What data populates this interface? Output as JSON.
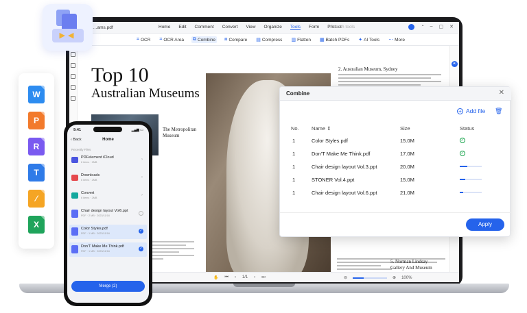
{
  "app": {
    "file_name": "…ams.pdf",
    "menu": [
      "Home",
      "Edit",
      "Comment",
      "Convert",
      "View",
      "Organize",
      "Tools",
      "Form",
      "Protect"
    ],
    "active_menu": "Tools",
    "search_placeholder": "Search tools"
  },
  "toolbar": {
    "tools": [
      {
        "label": "OCR",
        "icon": "ocr-icon"
      },
      {
        "label": "OCR Area",
        "icon": "ocr-area-icon"
      },
      {
        "label": "Combine",
        "icon": "combine-icon",
        "active": true
      },
      {
        "label": "Compare",
        "icon": "compare-icon"
      },
      {
        "label": "Compress",
        "icon": "compress-icon"
      },
      {
        "label": "Flatten",
        "icon": "flatten-icon"
      },
      {
        "label": "Batch PDFs",
        "icon": "batch-icon"
      },
      {
        "label": "AI Tools",
        "icon": "ai-icon"
      },
      {
        "label": "More",
        "icon": "more-icon"
      }
    ]
  },
  "document": {
    "title_line1": "Top 10",
    "title_line2": "Australian Museums",
    "photo_caption": "The Metropolitan Museum",
    "right_heading": "2. Australian Museum, Sydney",
    "section5_line1": "5. Norman Lindsay",
    "section5_line2": "Gallery And Museum"
  },
  "statusbar": {
    "page": "1/1",
    "zoom": "100%",
    "zoom_level": 0.32
  },
  "dialog": {
    "title": "Combine",
    "add_file": "Add file",
    "columns": {
      "no": "No.",
      "name": "Name",
      "size": "Size",
      "status": "Status"
    },
    "files": [
      {
        "no": "1",
        "name": "Color Styles.pdf",
        "size": "15.0M",
        "status": "done"
      },
      {
        "no": "1",
        "name": "Don'T Make Me Think.pdf",
        "size": "17.0M",
        "status": "done"
      },
      {
        "no": "1",
        "name": "Chair design layout Vol.3.ppt",
        "size": "20.0M",
        "status": "progress",
        "progress": 0.35
      },
      {
        "no": "1",
        "name": "STONER Vol.4.ppt",
        "size": "15.0M",
        "status": "progress",
        "progress": 0.25
      },
      {
        "no": "1",
        "name": "Chair design layout Vol.6.ppt",
        "size": "21.0M",
        "status": "progress",
        "progress": 0.15
      }
    ],
    "apply_label": "Apply"
  },
  "file_type_icons": [
    {
      "letter": "W",
      "color": "#2d8cf0",
      "icon": "word-icon"
    },
    {
      "letter": "P",
      "color": "#f27a2c",
      "icon": "powerpoint-icon"
    },
    {
      "letter": "R",
      "color": "#7a5af0",
      "icon": "rtf-icon"
    },
    {
      "letter": "T",
      "color": "#2f7be8",
      "icon": "text-icon"
    },
    {
      "letter": "⁄",
      "color": "#f5a524",
      "icon": "pages-icon"
    },
    {
      "letter": "X",
      "color": "#1fa45b",
      "icon": "excel-icon"
    }
  ],
  "phone": {
    "time": "9:41",
    "back": "Back",
    "title": "Home",
    "section": "Recently Files",
    "items": [
      {
        "name": "PDFelement iCloud",
        "meta": "6 items · 2MB",
        "color": "#4a55e0",
        "type": "folder",
        "control": "chevron",
        "selected": false
      },
      {
        "name": "Downloads",
        "meta": "6 items · 2MB",
        "color": "#e5484d",
        "type": "folder",
        "control": "chevron",
        "selected": false
      },
      {
        "name": "Convert",
        "meta": "6 items · 2MB",
        "color": "#13a89e",
        "type": "folder",
        "control": "chevron",
        "selected": false
      },
      {
        "name": "Chair design layout Vol6.ppt",
        "meta": "PDF · 2 MB · 2023/11/16",
        "color": "#5b6ef5",
        "type": "file",
        "control": "circle",
        "selected": false
      },
      {
        "name": "Color Styles.pdf",
        "meta": "PDF · 1 MB · 2023/11/16",
        "color": "#5b6ef5",
        "type": "file",
        "control": "check",
        "selected": true
      },
      {
        "name": "Don'T Make Me Think.pdf",
        "meta": "PDF · 1 MB · 2023/11/16",
        "color": "#5b6ef5",
        "type": "file",
        "control": "check",
        "selected": true
      }
    ],
    "merge_label": "Merge (2)"
  },
  "colors": {
    "accent": "#2563eb",
    "success": "#16a34a"
  }
}
